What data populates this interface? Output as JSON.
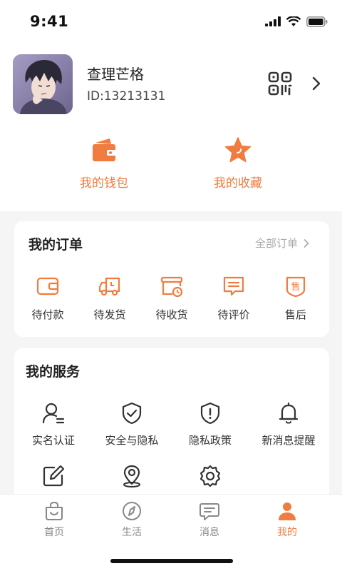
{
  "status_bar": {
    "time": "9:41"
  },
  "profile": {
    "name": "查理芒格",
    "id_text": "ID:13213131"
  },
  "quick_actions": [
    {
      "label": "我的钱包",
      "icon": "wallet-icon"
    },
    {
      "label": "我的收藏",
      "icon": "star-icon"
    }
  ],
  "orders": {
    "title": "我的订单",
    "all_label": "全部订单",
    "items": [
      {
        "label": "待付款",
        "icon": "wallet-icon"
      },
      {
        "label": "待发货",
        "icon": "truck-icon"
      },
      {
        "label": "待收货",
        "icon": "box-clock-icon"
      },
      {
        "label": "待评价",
        "icon": "comment-icon"
      },
      {
        "label": "售后",
        "icon": "shield-sale-icon"
      }
    ]
  },
  "services": {
    "title": "我的服务",
    "items": [
      {
        "label": "实名认证",
        "icon": "user-verify-icon"
      },
      {
        "label": "安全与隐私",
        "icon": "shield-check-icon"
      },
      {
        "label": "隐私政策",
        "icon": "shield-alert-icon"
      },
      {
        "label": "新消息提醒",
        "icon": "bell-icon"
      },
      {
        "label": "",
        "icon": "edit-icon"
      },
      {
        "label": "",
        "icon": "location-icon"
      },
      {
        "label": "",
        "icon": "settings-icon"
      }
    ]
  },
  "tabs": [
    {
      "label": "首页",
      "icon": "bag-icon"
    },
    {
      "label": "生活",
      "icon": "compass-icon"
    },
    {
      "label": "消息",
      "icon": "message-icon"
    },
    {
      "label": "我的",
      "icon": "person-icon",
      "active": true
    }
  ],
  "colors": {
    "accent": "#f07c3f",
    "text": "#222222",
    "muted": "#aaaaaa",
    "background": "#f5f5f5"
  }
}
